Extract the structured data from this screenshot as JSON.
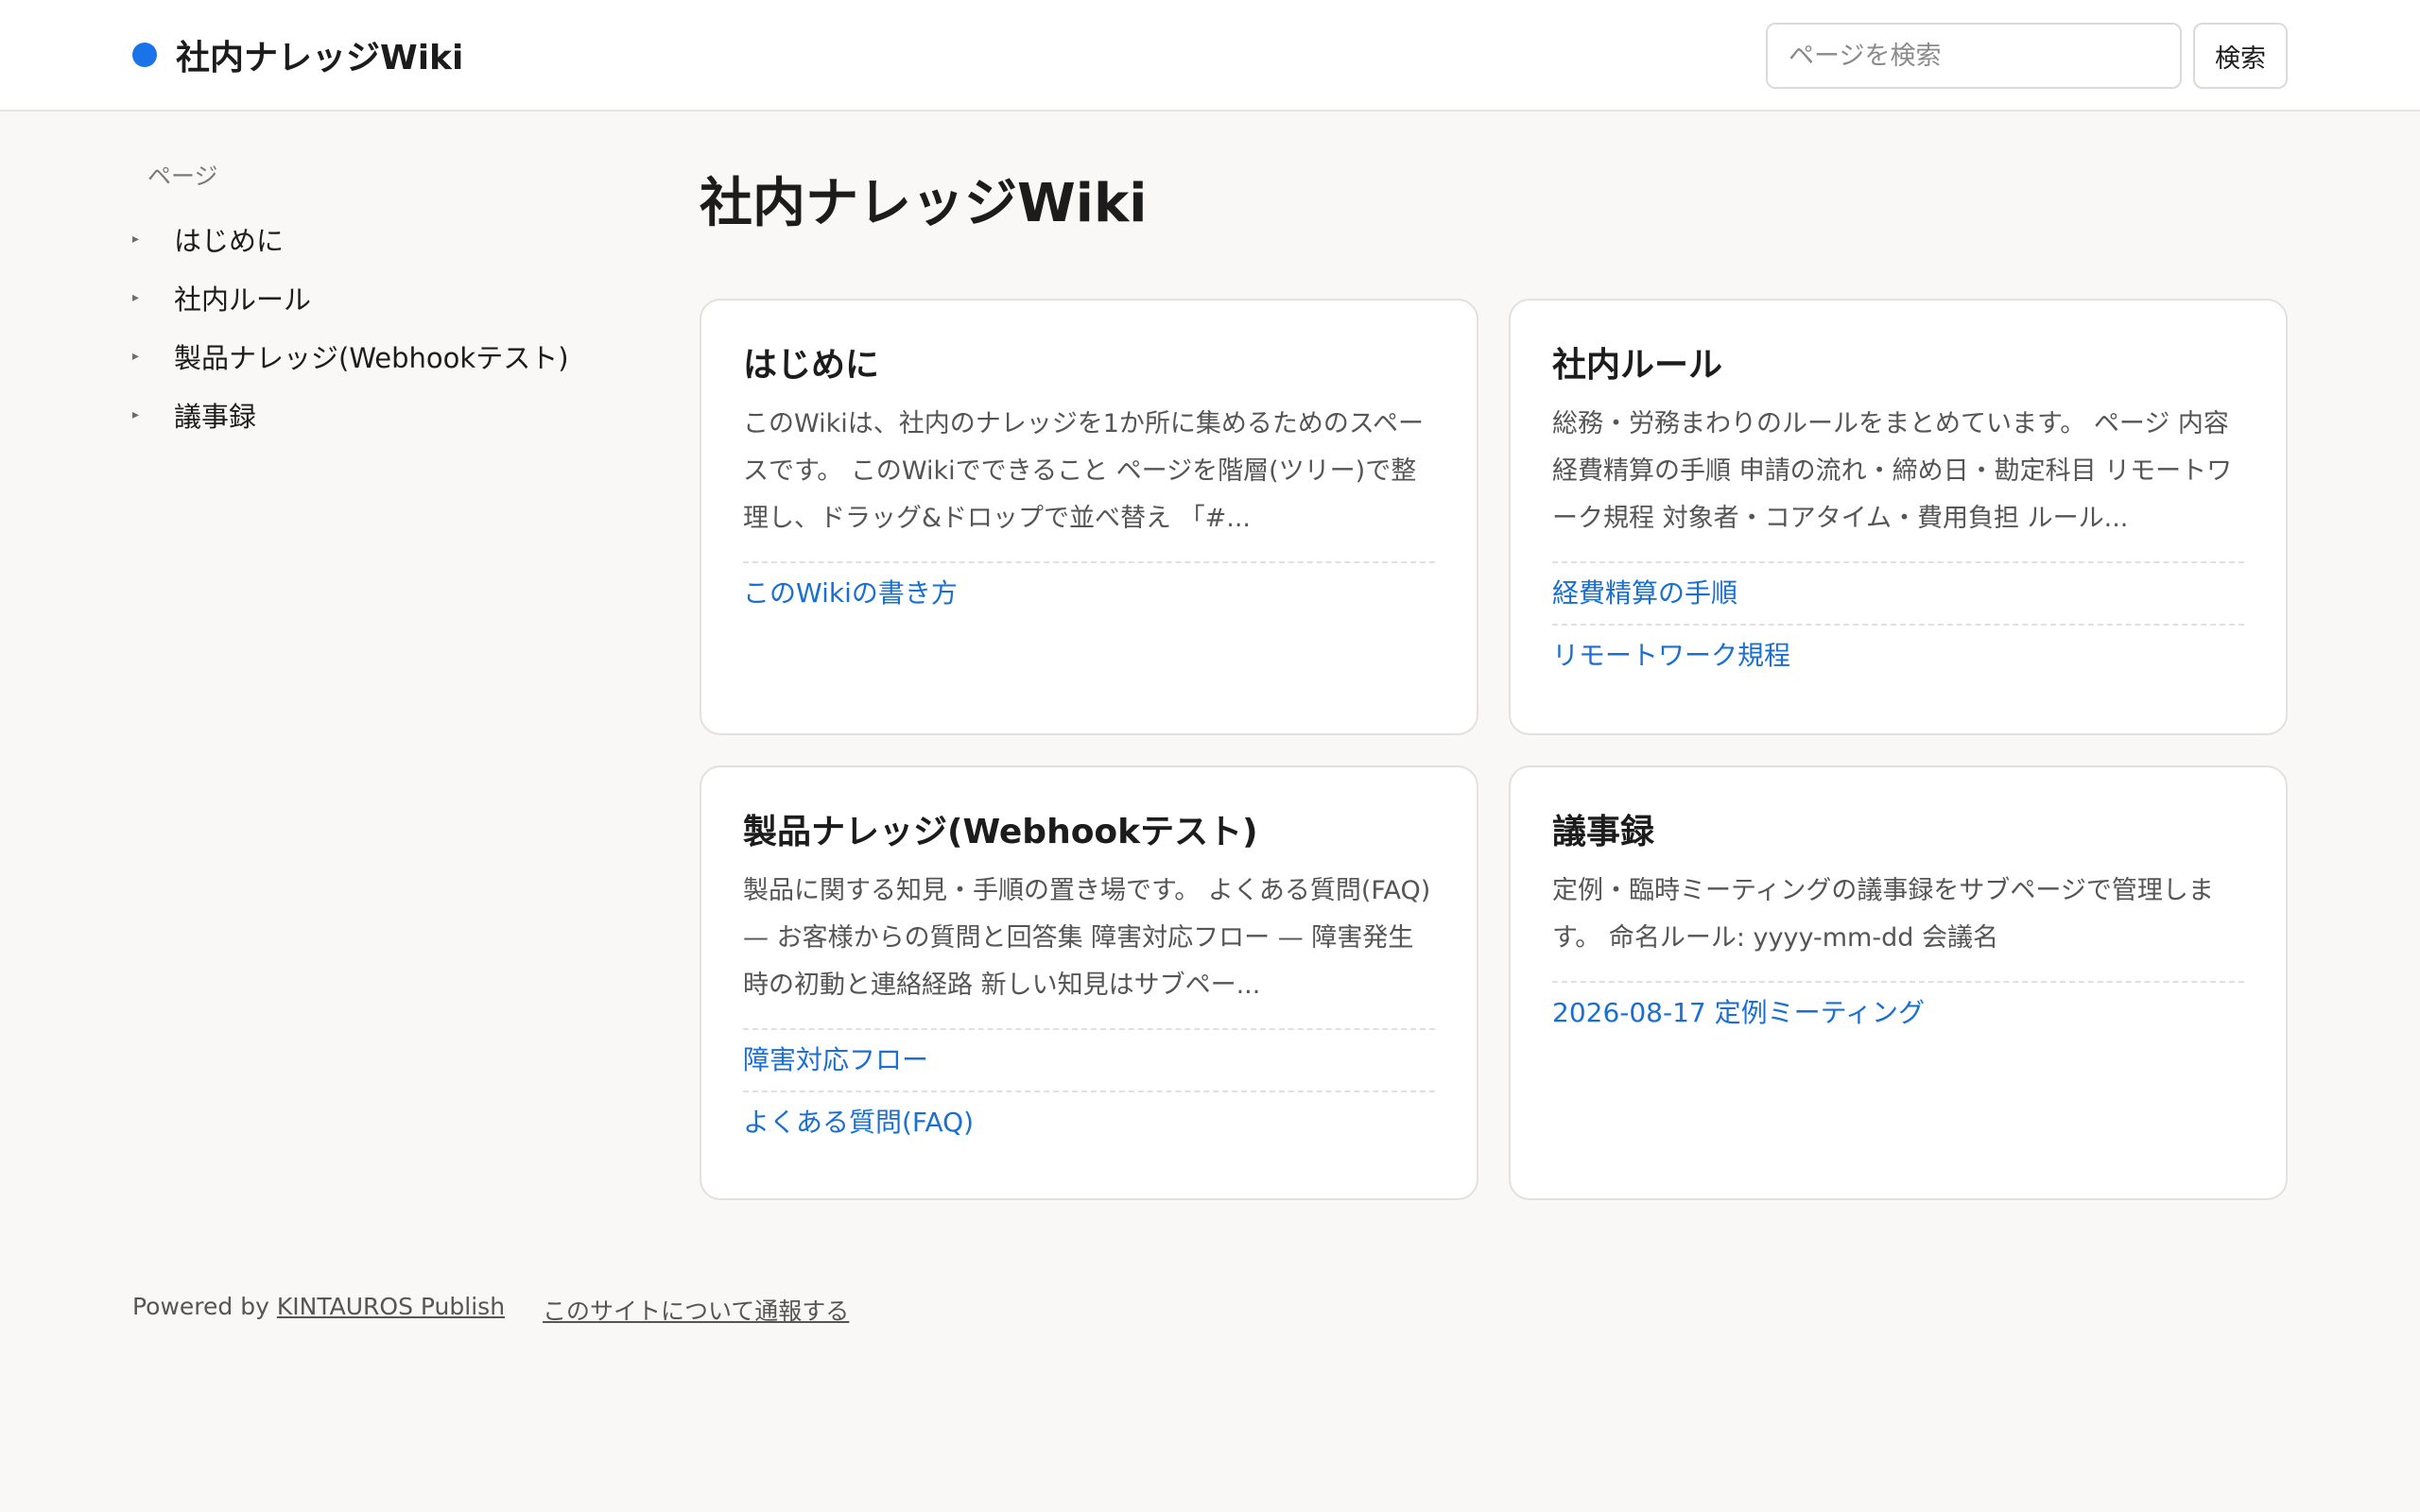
{
  "header": {
    "site_title": "社内ナレッジWiki",
    "search_placeholder": "ページを検索",
    "search_button": "検索",
    "brand_color": "#1a73e8"
  },
  "sidebar": {
    "heading": "ページ",
    "items": [
      {
        "label": "はじめに"
      },
      {
        "label": "社内ルール"
      },
      {
        "label": "製品ナレッジ(Webhookテスト)"
      },
      {
        "label": "議事録"
      }
    ]
  },
  "main": {
    "title": "社内ナレッジWiki",
    "cards": [
      {
        "title": "はじめに",
        "excerpt": "このWikiは、社内のナレッジを1か所に集めるためのスペースです。 このWikiでできること ページを階層(ツリー)で整理し、ドラッグ&ドロップで並べ替え 「#...",
        "links": [
          "このWikiの書き方"
        ]
      },
      {
        "title": "社内ルール",
        "excerpt": "総務・労務まわりのルールをまとめています。 ページ 内容 経費精算の手順 申請の流れ・締め日・勘定科目 リモートワーク規程 対象者・コアタイム・費用負担 ルール...",
        "links": [
          "経費精算の手順",
          "リモートワーク規程"
        ]
      },
      {
        "title": "製品ナレッジ(Webhookテスト)",
        "excerpt": "製品に関する知見・手順の置き場です。 よくある質問(FAQ) — お客様からの質問と回答集 障害対応フロー — 障害発生時の初動と連絡経路 新しい知見はサブペー...",
        "links": [
          "障害対応フロー",
          "よくある質問(FAQ)"
        ]
      },
      {
        "title": "議事録",
        "excerpt": "定例・臨時ミーティングの議事録をサブページで管理します。 命名ルール: yyyy-mm-dd 会議名",
        "links": [
          "2026-08-17 定例ミーティング"
        ]
      }
    ]
  },
  "footer": {
    "powered_prefix": "Powered by ",
    "powered_link": "KINTAUROS Publish",
    "report_link": "このサイトについて通報する"
  }
}
